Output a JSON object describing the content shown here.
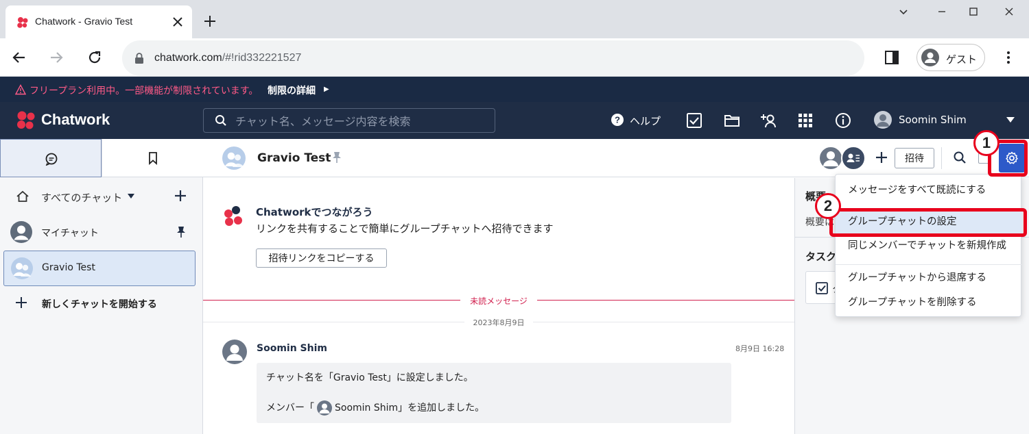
{
  "browser": {
    "tab_title": "Chatwork - Gravio Test",
    "url_host": "chatwork.com",
    "url_path": "/#!rid332221527",
    "profile_label": "ゲスト"
  },
  "banner": {
    "message": "フリープラン利用中。一部機能が制限されています。",
    "detail_link": "制限の詳細"
  },
  "header": {
    "brand": "Chatwork",
    "search_placeholder": "チャット名、メッセージ内容を検索",
    "help_label": "ヘルプ",
    "user_name": "Soomin Shim"
  },
  "sidebar": {
    "filter_label": "すべてのチャット",
    "rooms": [
      {
        "name": "マイチャット"
      },
      {
        "name": "Gravio Test"
      }
    ],
    "new_chat_label": "新しくチャットを開始する"
  },
  "room": {
    "title": "Gravio Test",
    "invite_button": "招待"
  },
  "timeline": {
    "promo_title": "Chatworkでつながろう",
    "promo_text": "リンクを共有することで簡単にグループチャットへ招待できます",
    "promo_button": "招待リンクをコピーする",
    "unread_label": "未読メッセージ",
    "date_label": "2023年8月9日",
    "message": {
      "author": "Soomin Shim",
      "time": "8月9日 16:28",
      "line1": "チャット名を「Gravio Test」に設定しました。",
      "line2_prefix": "メンバー「",
      "line2_name": "Soomin Shim",
      "line2_suffix": "」を追加しました。"
    }
  },
  "right_panel": {
    "overview_heading": "概要",
    "overview_text": "概要は",
    "tasks_heading": "タスク",
    "task_card_text": "タ"
  },
  "menu": {
    "items": [
      {
        "label": "メッセージをすべて既読にする"
      },
      {
        "label": "グループチャットの設定"
      },
      {
        "label": "同じメンバーでチャットを新規作成"
      },
      {
        "label": "グループチャットから退席する"
      },
      {
        "label": "グループチャットを削除する"
      }
    ]
  },
  "callouts": {
    "step1": "1",
    "step2": "2"
  },
  "colors": {
    "header_bg": "#1f2d45",
    "banner_bg": "#1a2a44",
    "banner_warning": "#ff5a87",
    "accent_blue": "#2d5ac9",
    "highlight_red": "#e8001c",
    "unread_red": "#d1204e"
  }
}
